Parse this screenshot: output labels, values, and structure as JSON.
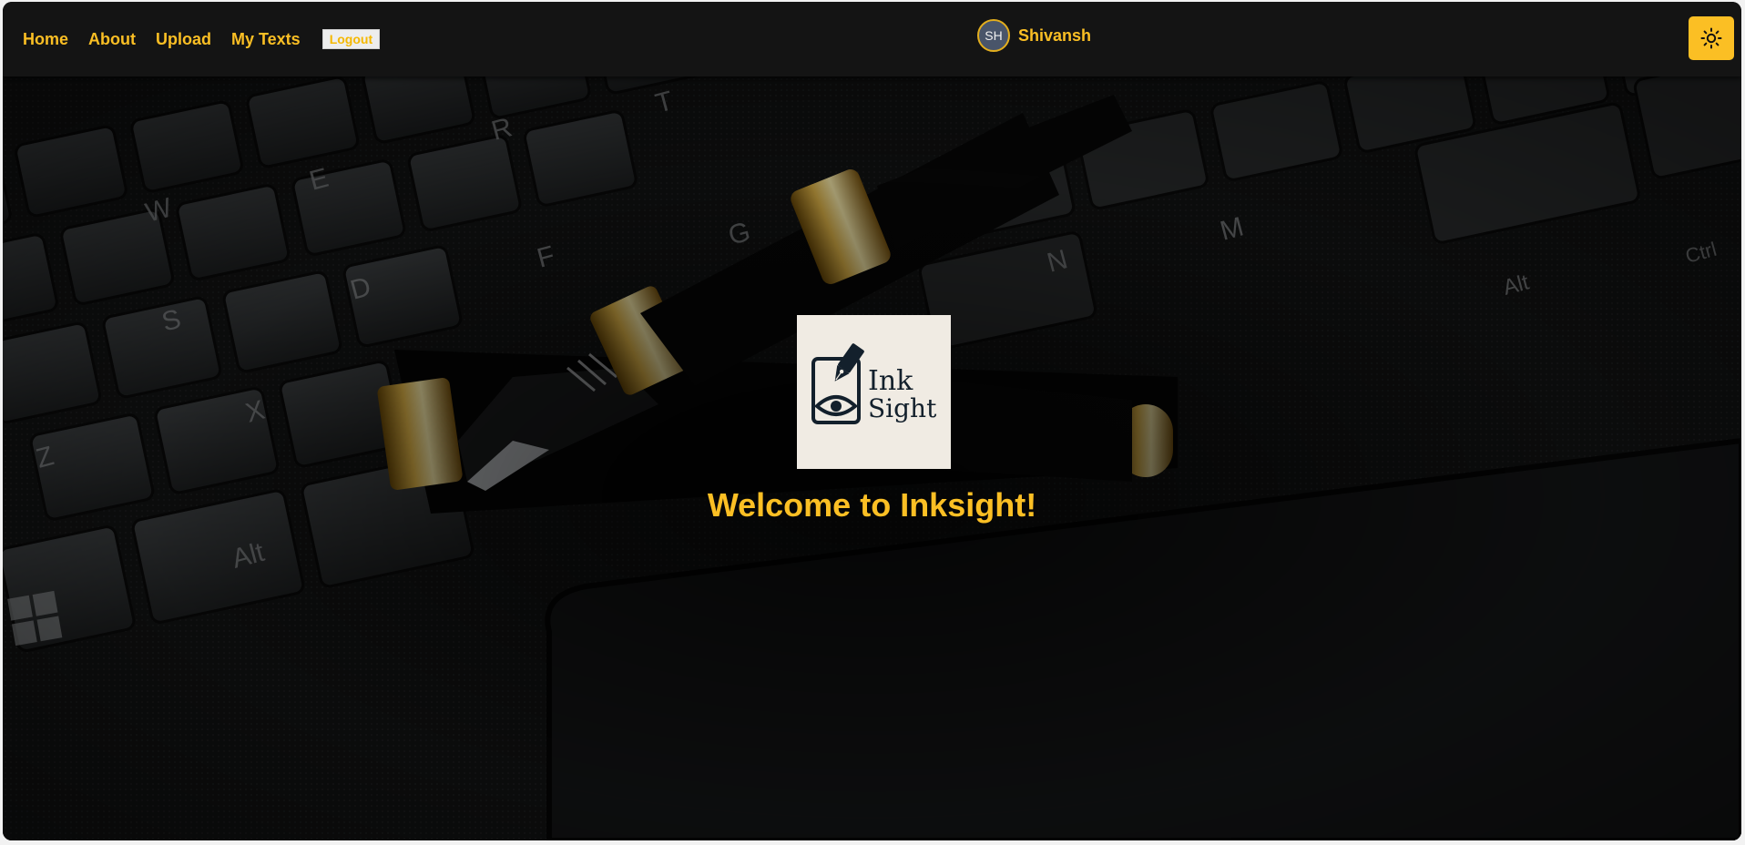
{
  "nav": {
    "links": [
      "Home",
      "About",
      "Upload",
      "My Texts"
    ],
    "logout_label": "Logout"
  },
  "user": {
    "initials": "SH",
    "name": "Shivansh"
  },
  "theme_toggle": {
    "icon": "sun-icon"
  },
  "hero": {
    "logo": {
      "line1": "Ink",
      "line2": "Sight"
    },
    "welcome": "Welcome to Inksight!"
  },
  "colors": {
    "accent": "#fbbf24",
    "navbar_bg": "#141414",
    "logo_bg": "#f0ebe3",
    "logo_ink": "#13202c"
  }
}
